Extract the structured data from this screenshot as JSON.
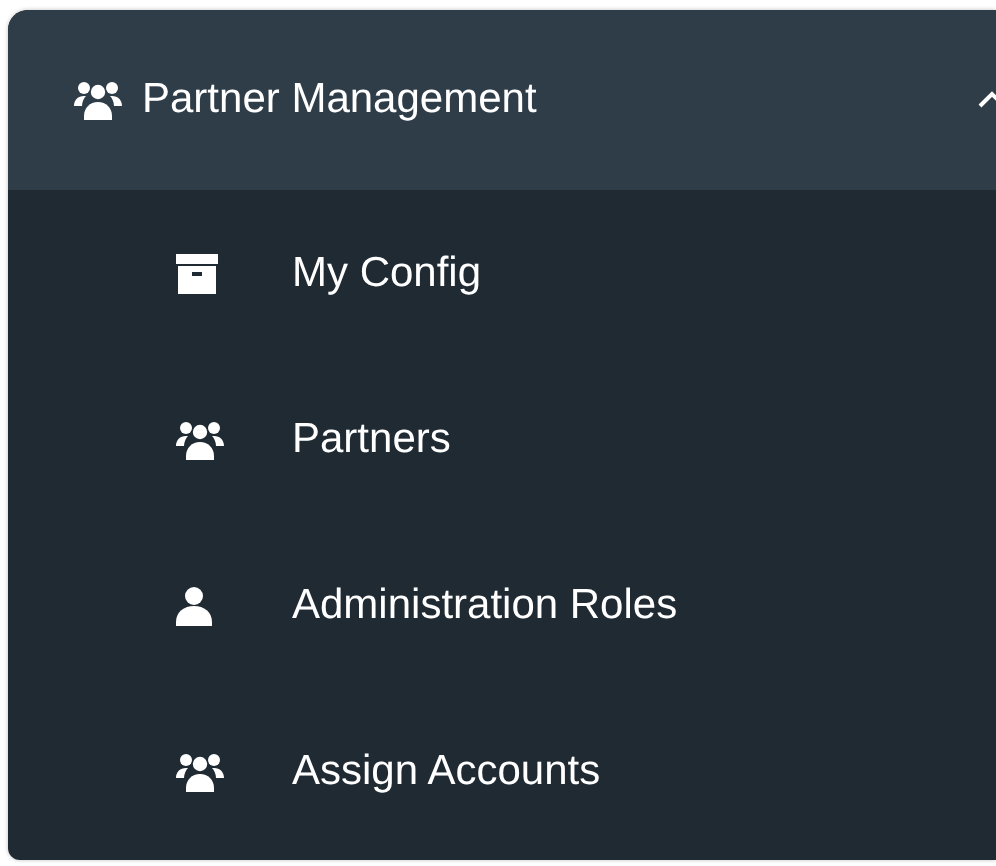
{
  "menu_group": {
    "label": "Partner Management",
    "kind": "group",
    "expanded": true
  },
  "items": [
    {
      "label": "My Config",
      "kind": "archive"
    },
    {
      "label": "Partners",
      "kind": "group"
    },
    {
      "label": "Administration Roles",
      "kind": "person"
    },
    {
      "label": "Assign Accounts",
      "kind": "group"
    }
  ]
}
